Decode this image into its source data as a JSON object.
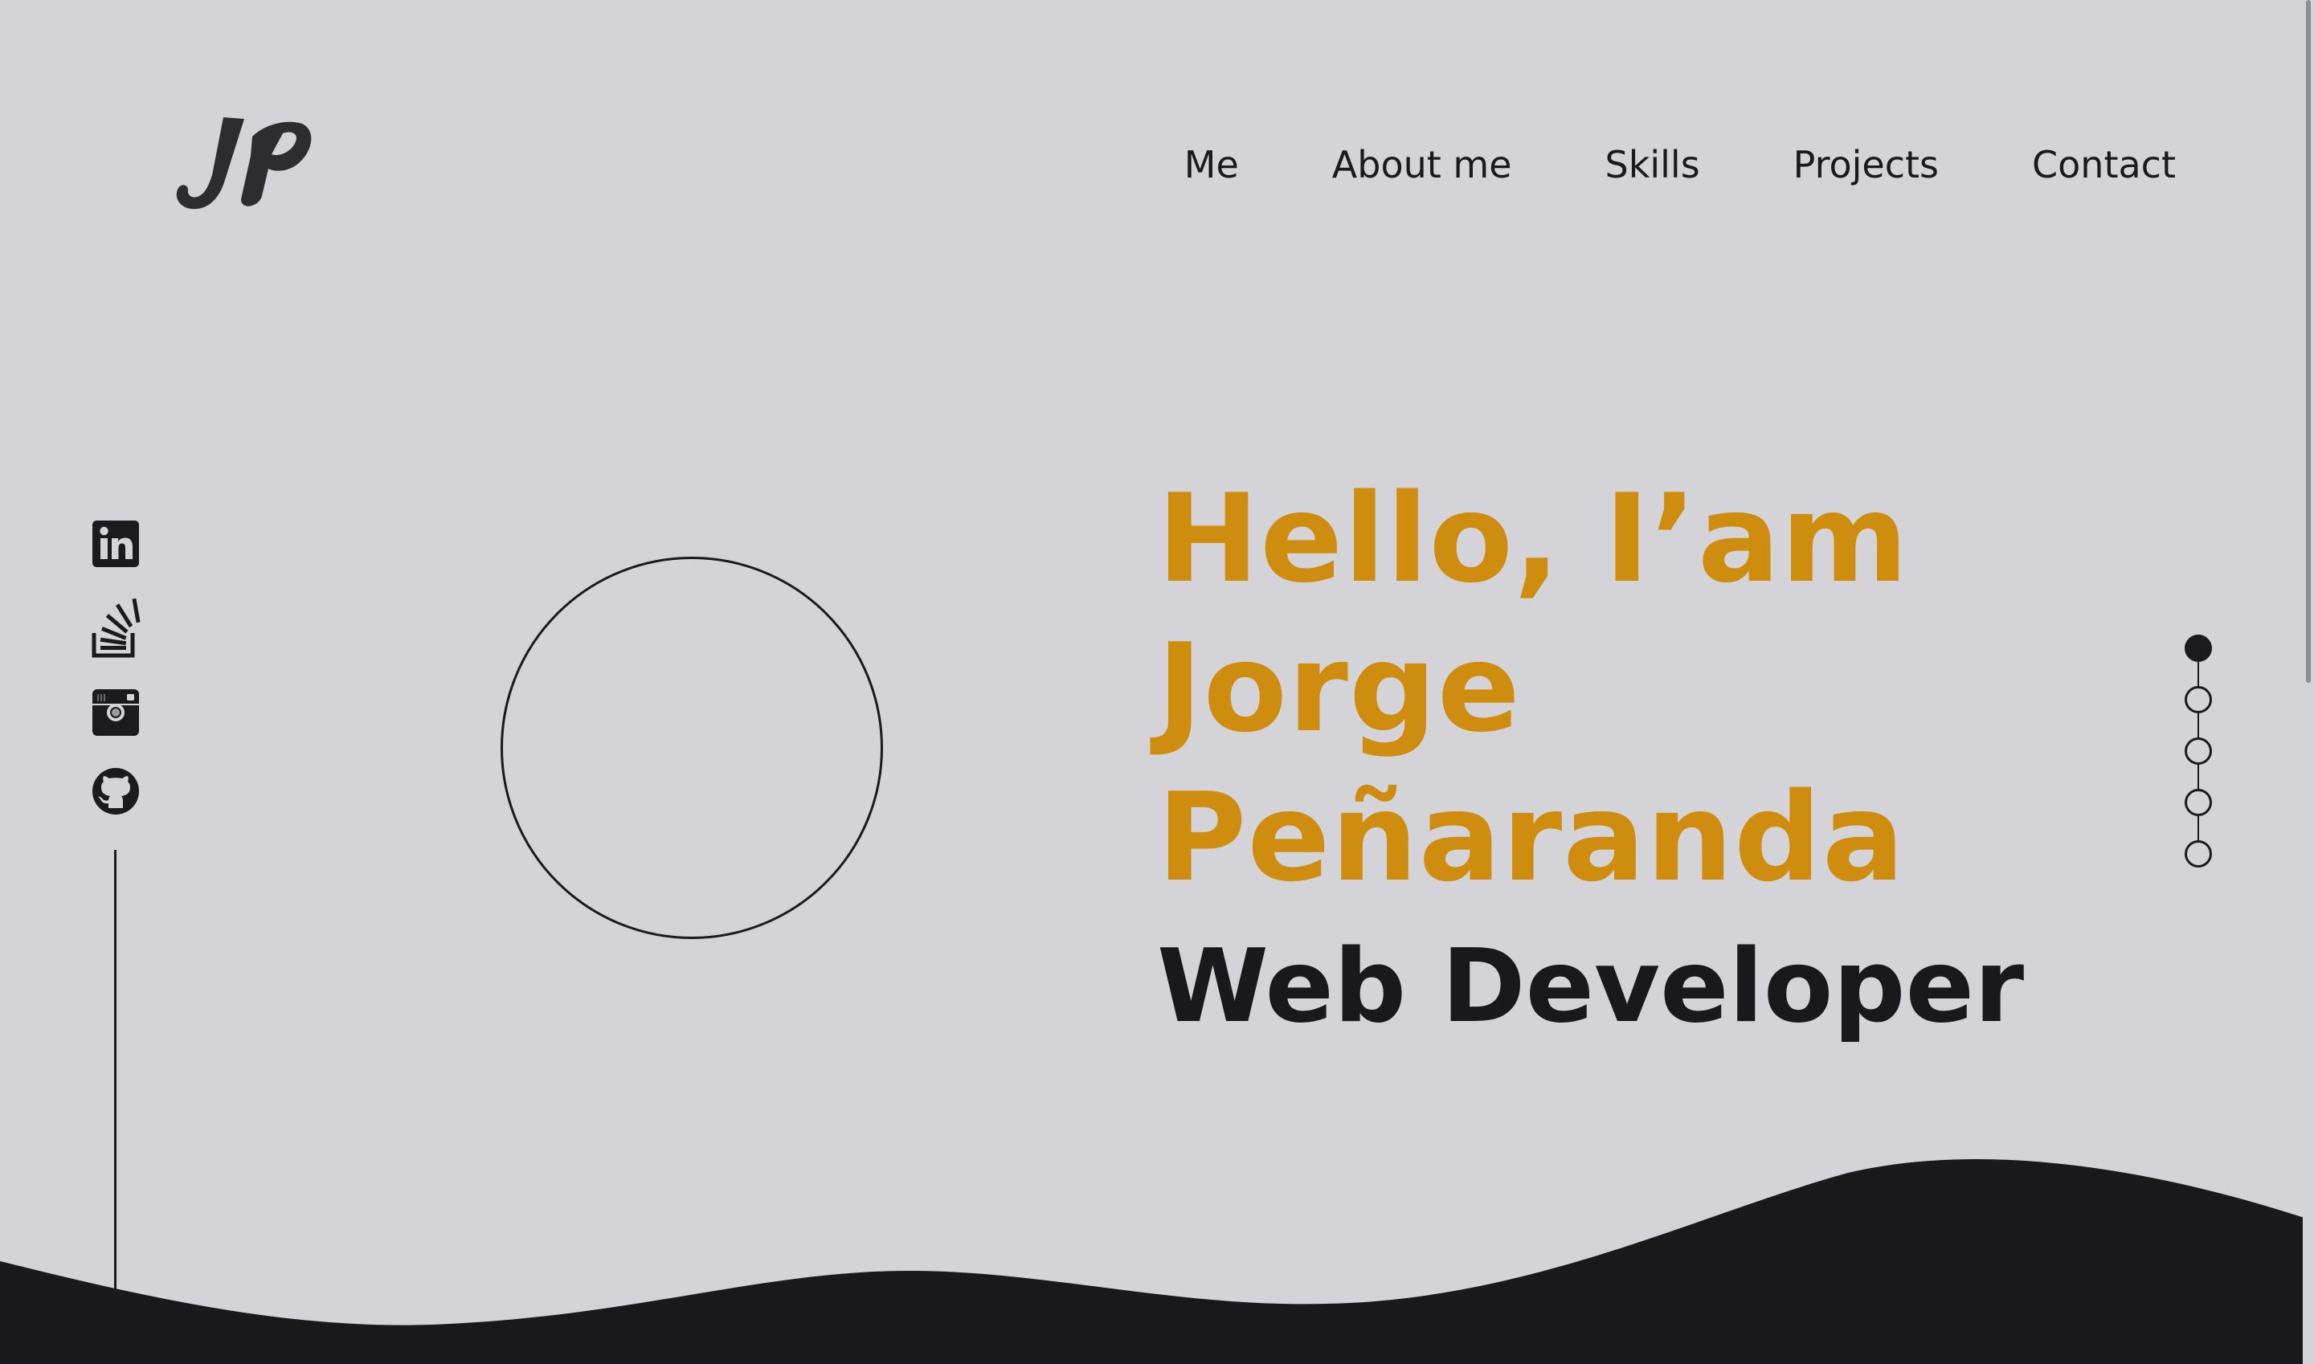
{
  "logo": {
    "text": "JP",
    "icon": "jp-monogram-logo"
  },
  "nav": {
    "items": [
      {
        "label": "Me"
      },
      {
        "label": "About me"
      },
      {
        "label": "Skills"
      },
      {
        "label": "Projects"
      },
      {
        "label": "Contact"
      }
    ]
  },
  "social": {
    "icons": [
      "linkedin-icon",
      "stackoverflow-icon",
      "instagram-icon",
      "github-icon"
    ]
  },
  "hero": {
    "line1": "Hello, I’am",
    "line2": "Jorge",
    "line3": "Peñaranda",
    "role": "Web Developer"
  },
  "section_dots": {
    "count": 5,
    "active_index": 0
  },
  "colors": {
    "background": "#d4d3d8",
    "accent": "#cf8d0f",
    "dark": "#19191b"
  }
}
